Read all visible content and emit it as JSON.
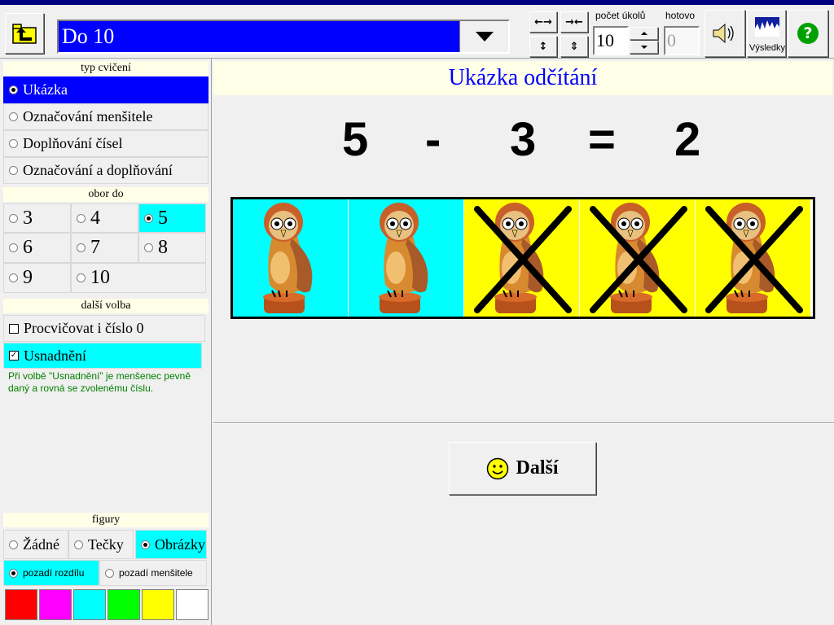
{
  "toolbar": {
    "combo_value": "Do 10",
    "pocet_label": "počet úkolů",
    "pocet_value": "10",
    "hotovo_label": "hotovo",
    "hotovo_value": "0",
    "results_label": "Výsledky",
    "help_glyph": "?"
  },
  "left": {
    "typ_header": "typ cvičení",
    "typ_items": [
      "Ukázka",
      "Označování menšitele",
      "Doplňování čísel",
      "Označování a doplňování"
    ],
    "obor_header": "obor do",
    "obor_items": [
      "3",
      "4",
      "5",
      "6",
      "7",
      "8",
      "9",
      "10"
    ],
    "dalsi_header": "další volba",
    "procvicovat": "Procvičovat i číslo 0",
    "usnadneni": "Usnadnění",
    "note": "Při volbě \"Usnadnění\" je menšenec pevně daný a rovná se zvolenému číslu.",
    "figury_header": "figury",
    "figury_items": [
      "Žádné",
      "Tečky",
      "Obrázky"
    ],
    "pozadi_rozdilu": "pozadí rozdílu",
    "pozadi_mensitele": "pozadí menšitele",
    "swatches": [
      "#ff0000",
      "#ff00ff",
      "#00ffff",
      "#00ff00",
      "#ffff00",
      "#ffffff"
    ]
  },
  "main": {
    "title": "Ukázka odčítání",
    "equation": {
      "a": "5",
      "op": "-",
      "b": "3",
      "eq": "=",
      "result": "2"
    },
    "next_label": "Další"
  },
  "owls": {
    "kept": 2,
    "crossed": 3,
    "kept_bg": "#00ffff",
    "crossed_bg": "#ffff00"
  }
}
